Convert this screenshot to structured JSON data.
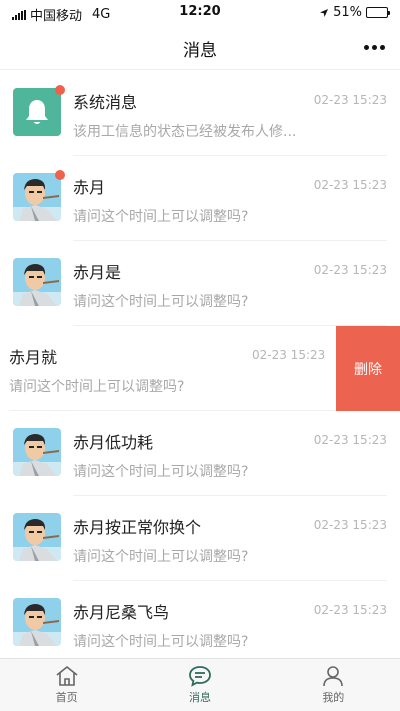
{
  "status_bar": {
    "carrier": "中国移动",
    "network": "4G",
    "time": "12:20",
    "battery": "51%",
    "battery_level": 0.51
  },
  "nav": {
    "title": "消息"
  },
  "messages": [
    {
      "name": "系统消息",
      "time": "02-23 15:23",
      "preview": "该用工信息的状态已经被发布人修...",
      "unread": true
    },
    {
      "name": "赤月",
      "time": "02-23 15:23",
      "preview": "请问这个时间上可以调整吗?",
      "unread": true
    },
    {
      "name": "赤月是",
      "time": "02-23 15:23",
      "preview": "请问这个时间上可以调整吗?",
      "unread": false
    },
    {
      "name": "赤月就",
      "time": "02-23 15:23",
      "preview": "请问这个时间上可以调整吗?",
      "unread": false,
      "delete_label": "删除"
    },
    {
      "name": "赤月低功耗",
      "time": "02-23 15:23",
      "preview": "请问这个时间上可以调整吗?",
      "unread": false
    },
    {
      "name": "赤月按正常你换个",
      "time": "02-23 15:23",
      "preview": "请问这个时间上可以调整吗?",
      "unread": false
    },
    {
      "name": "赤月尼桑飞鸟",
      "time": "02-23 15:23",
      "preview": "请问这个时间上可以调整吗?",
      "unread": false
    }
  ],
  "tabs": [
    {
      "label": "首页",
      "icon": "home-icon",
      "active": false
    },
    {
      "label": "消息",
      "icon": "message-icon",
      "active": true
    },
    {
      "label": "我的",
      "icon": "person-icon",
      "active": false
    }
  ],
  "colors": {
    "accent": "#2f6b5d",
    "system_icon_bg": "#4fb59b",
    "unread_dot": "#f0614b",
    "delete_bg": "#ec6450"
  }
}
